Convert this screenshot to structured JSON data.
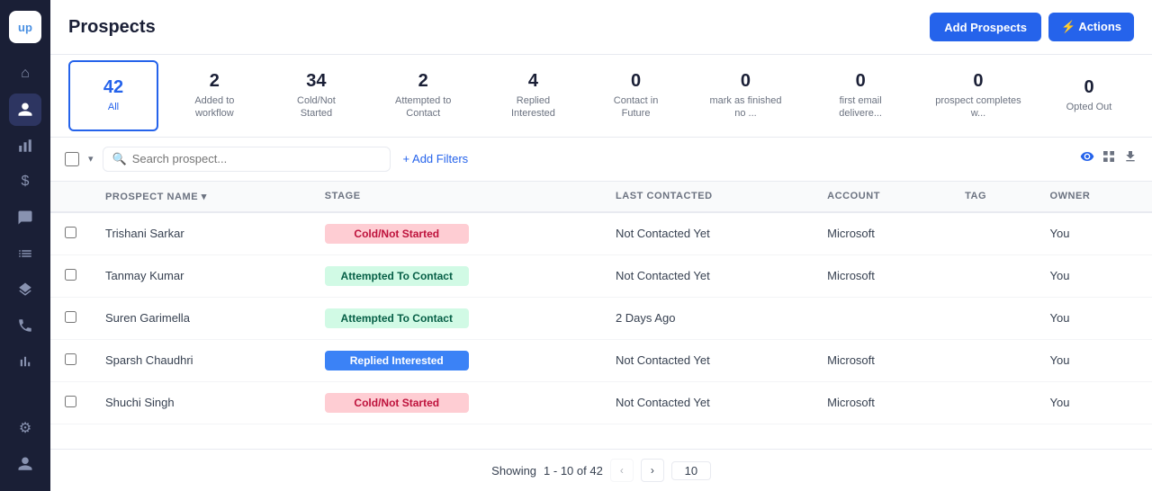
{
  "app": {
    "logo": "up",
    "title": "Prospects"
  },
  "sidebar": {
    "icons": [
      {
        "name": "home-icon",
        "symbol": "⌂",
        "active": false
      },
      {
        "name": "users-icon",
        "symbol": "👤",
        "active": true
      },
      {
        "name": "chart-icon",
        "symbol": "📊",
        "active": false
      },
      {
        "name": "dollar-icon",
        "symbol": "$",
        "active": false
      },
      {
        "name": "message-icon",
        "symbol": "💬",
        "active": false
      },
      {
        "name": "list-icon",
        "symbol": "≡",
        "active": false
      },
      {
        "name": "layers-icon",
        "symbol": "⬛",
        "active": false
      },
      {
        "name": "phone-icon",
        "symbol": "📞",
        "active": false
      },
      {
        "name": "bar-chart-icon",
        "symbol": "📈",
        "active": false
      }
    ],
    "bottom_icons": [
      {
        "name": "gear-icon",
        "symbol": "⚙"
      },
      {
        "name": "avatar-icon",
        "symbol": "👤"
      }
    ]
  },
  "header": {
    "title": "Prospects",
    "add_prospects_label": "Add Prospects",
    "actions_label": "⚡ Actions"
  },
  "stats": [
    {
      "id": "all",
      "number": "42",
      "label": "All",
      "active": true
    },
    {
      "id": "added",
      "number": "2",
      "label": "Added to workflow",
      "active": false
    },
    {
      "id": "cold",
      "number": "34",
      "label": "Cold/Not Started",
      "active": false
    },
    {
      "id": "attempted",
      "number": "2",
      "label": "Attempted to Contact",
      "active": false
    },
    {
      "id": "replied",
      "number": "4",
      "label": "Replied Interested",
      "active": false
    },
    {
      "id": "contact-future",
      "number": "0",
      "label": "Contact in Future",
      "active": false
    },
    {
      "id": "mark-finished",
      "number": "0",
      "label": "mark as finished no ...",
      "active": false
    },
    {
      "id": "first-email",
      "number": "0",
      "label": "first email delivere...",
      "active": false
    },
    {
      "id": "prospect-completes",
      "number": "0",
      "label": "prospect completes w...",
      "active": false
    },
    {
      "id": "opted-out",
      "number": "0",
      "label": "Opted Out",
      "active": false
    }
  ],
  "filters": {
    "search_placeholder": "Search prospect...",
    "add_filters_label": "+ Add Filters"
  },
  "table": {
    "columns": [
      {
        "id": "prospect-name",
        "label": "PROSPECT NAME ▾"
      },
      {
        "id": "stage",
        "label": "STAGE"
      },
      {
        "id": "last-contacted",
        "label": "LAST CONTACTED"
      },
      {
        "id": "account",
        "label": "ACCOUNT"
      },
      {
        "id": "tag",
        "label": "TAG"
      },
      {
        "id": "owner",
        "label": "OWNER"
      }
    ],
    "rows": [
      {
        "name": "Trishani Sarkar",
        "stage": "Cold/Not Started",
        "stage_type": "cold",
        "last_contacted": "Not Contacted Yet",
        "account": "Microsoft",
        "tag": "",
        "owner": "You"
      },
      {
        "name": "Tanmay Kumar",
        "stage": "Attempted To Contact",
        "stage_type": "attempted",
        "last_contacted": "Not Contacted Yet",
        "account": "Microsoft",
        "tag": "",
        "owner": "You"
      },
      {
        "name": "Suren Garimella",
        "stage": "Attempted To Contact",
        "stage_type": "attempted",
        "last_contacted": "2 Days Ago",
        "account": "",
        "tag": "",
        "owner": "You"
      },
      {
        "name": "Sparsh Chaudhri",
        "stage": "Replied Interested",
        "stage_type": "replied",
        "last_contacted": "Not Contacted Yet",
        "account": "Microsoft",
        "tag": "",
        "owner": "You"
      },
      {
        "name": "Shuchi Singh",
        "stage": "Cold/Not Started",
        "stage_type": "cold",
        "last_contacted": "Not Contacted Yet",
        "account": "Microsoft",
        "tag": "",
        "owner": "You"
      }
    ]
  },
  "pagination": {
    "showing_label": "Showing",
    "range": "1 - 10 of 42",
    "page_size": "10"
  }
}
